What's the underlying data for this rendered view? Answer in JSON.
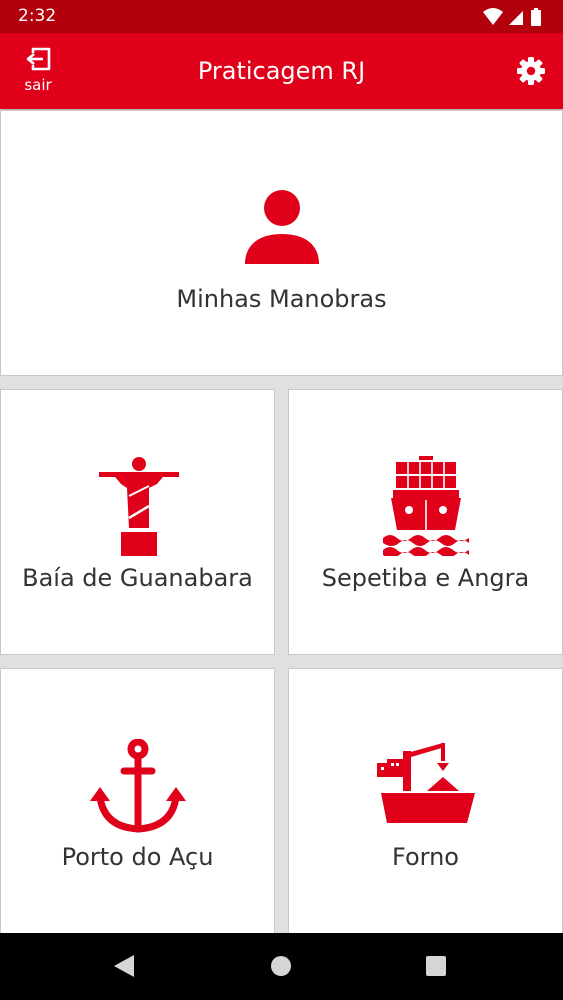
{
  "status_bar": {
    "time": "2:32",
    "icons": [
      "wifi-icon",
      "signal-icon",
      "battery-icon"
    ]
  },
  "app_bar": {
    "title": "Praticagem RJ",
    "exit_label": "sair",
    "exit_icon": "exit-icon",
    "settings_icon": "gear-icon"
  },
  "tiles": [
    {
      "label": "Minhas Manobras",
      "icon": "person-icon"
    },
    {
      "label": "Baía de Guanabara",
      "icon": "christ-redeemer-icon"
    },
    {
      "label": "Sepetiba e Angra",
      "icon": "container-ship-icon"
    },
    {
      "label": "Porto do Açu",
      "icon": "anchor-icon"
    },
    {
      "label": "Forno",
      "icon": "cargo-ship-crane-icon"
    }
  ],
  "nav_bar": {
    "items": [
      "back-icon",
      "home-icon",
      "recents-icon"
    ]
  },
  "colors": {
    "primary": "#e0001a",
    "status_bar": "#b3000d",
    "background": "#e0e0e0",
    "tile": "#ffffff",
    "icon_red": "#e0001a"
  }
}
